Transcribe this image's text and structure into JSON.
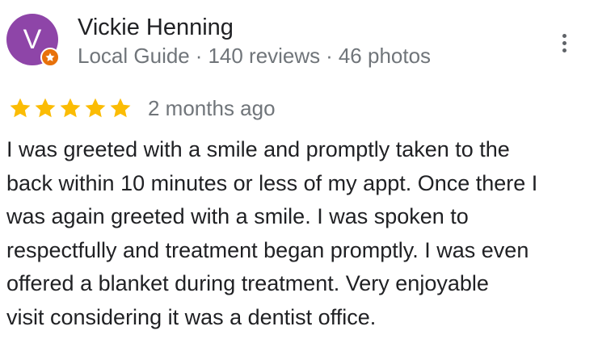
{
  "reviewer": {
    "avatar_initial": "V",
    "avatar_color": "#8e45a8",
    "badge_icon": "local-guide-star-icon",
    "badge_color": "#e8710a",
    "name": "Vickie Henning",
    "level": "Local Guide",
    "separator": "·",
    "reviews": "140 reviews",
    "photos": "46 photos"
  },
  "more_options_icon": "more-vert-icon",
  "rating": {
    "stars": 5,
    "max_stars": 5,
    "star_color": "#fbbc04",
    "date": "2 months ago"
  },
  "review_text": "I was greeted with a smile and promptly taken to the\nback within 10 minutes or less of my appt. Once there I\nwas again greeted with a smile.  I was spoken to\nrespectfully and treatment began promptly. I was even\noffered a blanket during treatment.  Very enjoyable\nvisit considering it was a dentist office."
}
